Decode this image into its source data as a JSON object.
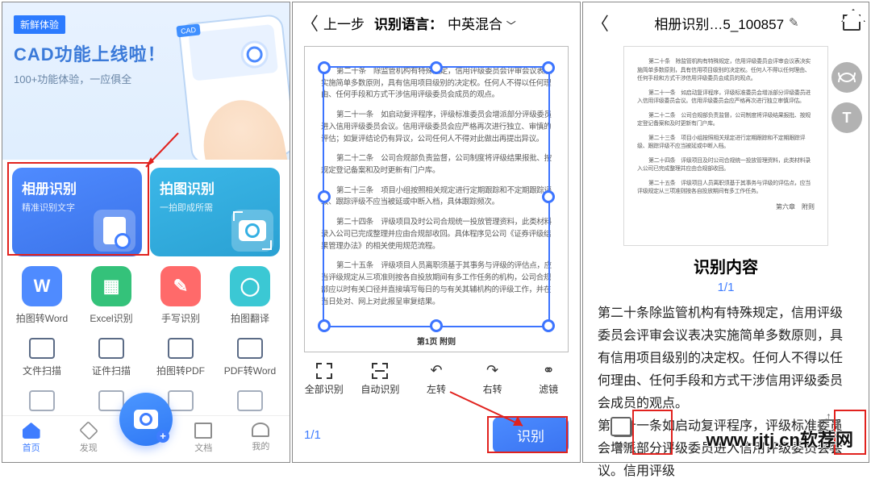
{
  "frame1": {
    "badge": "新鲜体验",
    "banner_title": "CAD功能上线啦！",
    "banner_sub": "100+功能体验，一应俱全",
    "card_album": {
      "title": "相册识别",
      "sub": "精准识别文字"
    },
    "card_photo": {
      "title": "拍图识别",
      "sub": "一拍即成所需"
    },
    "grid1": [
      {
        "label": "拍图转Word",
        "glyph": "W"
      },
      {
        "label": "Excel识别",
        "glyph": "▦"
      },
      {
        "label": "手写识别",
        "glyph": "✎"
      },
      {
        "label": "拍图翻译",
        "glyph": "◯"
      }
    ],
    "grid2": [
      {
        "label": "文件扫描"
      },
      {
        "label": "证件扫描"
      },
      {
        "label": "拍图转PDF"
      },
      {
        "label": "PDF转Word"
      }
    ],
    "nav": {
      "home": "首页",
      "discover": "发现",
      "docs": "文档",
      "me": "我的"
    }
  },
  "frame2": {
    "back": "上一步",
    "lang_label": "识别语言：",
    "lang_value": "中英混合",
    "toolbar": {
      "all": "全部识别",
      "auto": "自动识别",
      "left": "左转",
      "right": "右转",
      "filter": "滤镜"
    },
    "page_indicator": "1/1",
    "recognize_btn": "识别",
    "doc_page_label": "第1页 附则",
    "doc_paragraphs": [
      "第二十条　除监管机构有特殊规定，信用评级委员会评审会议表决实施简单多数原则，具有信用项目级别的决定权。任何人不得以任何理由、任何手段和方式干涉信用评级委员会成员的观点。",
      "第二十一条　如启动复评程序，评级标准委员会增派部分评级委员进入信用评级委员会议。信用评级委员会应严格再次进行独立、审慎的评估；如复评结论仍有异议，公司任何人不得对此做出再提出异议。",
      "第二十二条　公司合规部负责监督，公司制度将评级结果报批、按规定登记备案和及时更新有门户库。",
      "第二十三条　项目小组按照相关规定进行定期跟踪和不定期跟踪评级、跟踪评级不应当被延或中断入档，具体跟踪频次。",
      "第二十四条　评级项目及时公司合规统一投放管理资料，此类材料录入公司已完成整理并应由合规部收回。具体程序见公司《证券评级结果管理办法》的相关使用规范流程。",
      "第二十五条　评级项目人员离职须基于其事务与评级的评估点，应当评级规定从三项准则按各自投放期间有多工作任务的机构，公司合规部应以时有关口径并直接填写每日的与有关其辅机构的评级工作，并在当日处对、网上对此报呈审复结果。"
    ]
  },
  "frame3": {
    "title": "相册识别…5_100857",
    "section_title": "识别内容",
    "section_page": "1/1",
    "body": [
      "第二十条除监管机构有特殊规定，信用评级委员会评审会议表决实施简单多数原则，具有信用项目级别的决定权。任何人不得以任何理由、任何手段和方式干涉信用评级委员会成员的观点。",
      "第二十一条如启动复评程序，评级标准委员会增派部分评级委员进入信用评级委员会会议。信用评级"
    ],
    "footer": {
      "copy": "复制",
      "export": "导出"
    },
    "preview_paragraphs": [
      "第二十条　除监管机构有特殊规定，信用评级委员会评审会议表决实施简单多数原则，具有信用项目级别的决定权。任何人不得以任何理由、任何手段和方式干涉信用评级委员会成员的观点。",
      "第二十一条　如启动复评程序，评级标准委员会增派部分评级委员进入信用评级委员会议。信用评级委员会应严格再次进行独立审慎评估。",
      "第二十二条　公司合规部负责监督，公司制度将评级结果报批、按规定登记备案和及时更新有门户库。",
      "第二十三条　项目小组按照相关规定进行定期跟踪和不定期跟踪评级、跟踪评级不应当被延或中断入档。",
      "第二十四条　评级项目及时公司合规统一投放管理资料，此类材料录入公司已完成整理并应由合规部收回。",
      "第二十五条　评级项目人员离职须基于其事务与评级的评估点，应当评级规定从三项准则按各自投放期间有多工作任务。"
    ],
    "preview_footer": "第六章　附则"
  },
  "watermark": "www.rjtj.cn软荐网"
}
